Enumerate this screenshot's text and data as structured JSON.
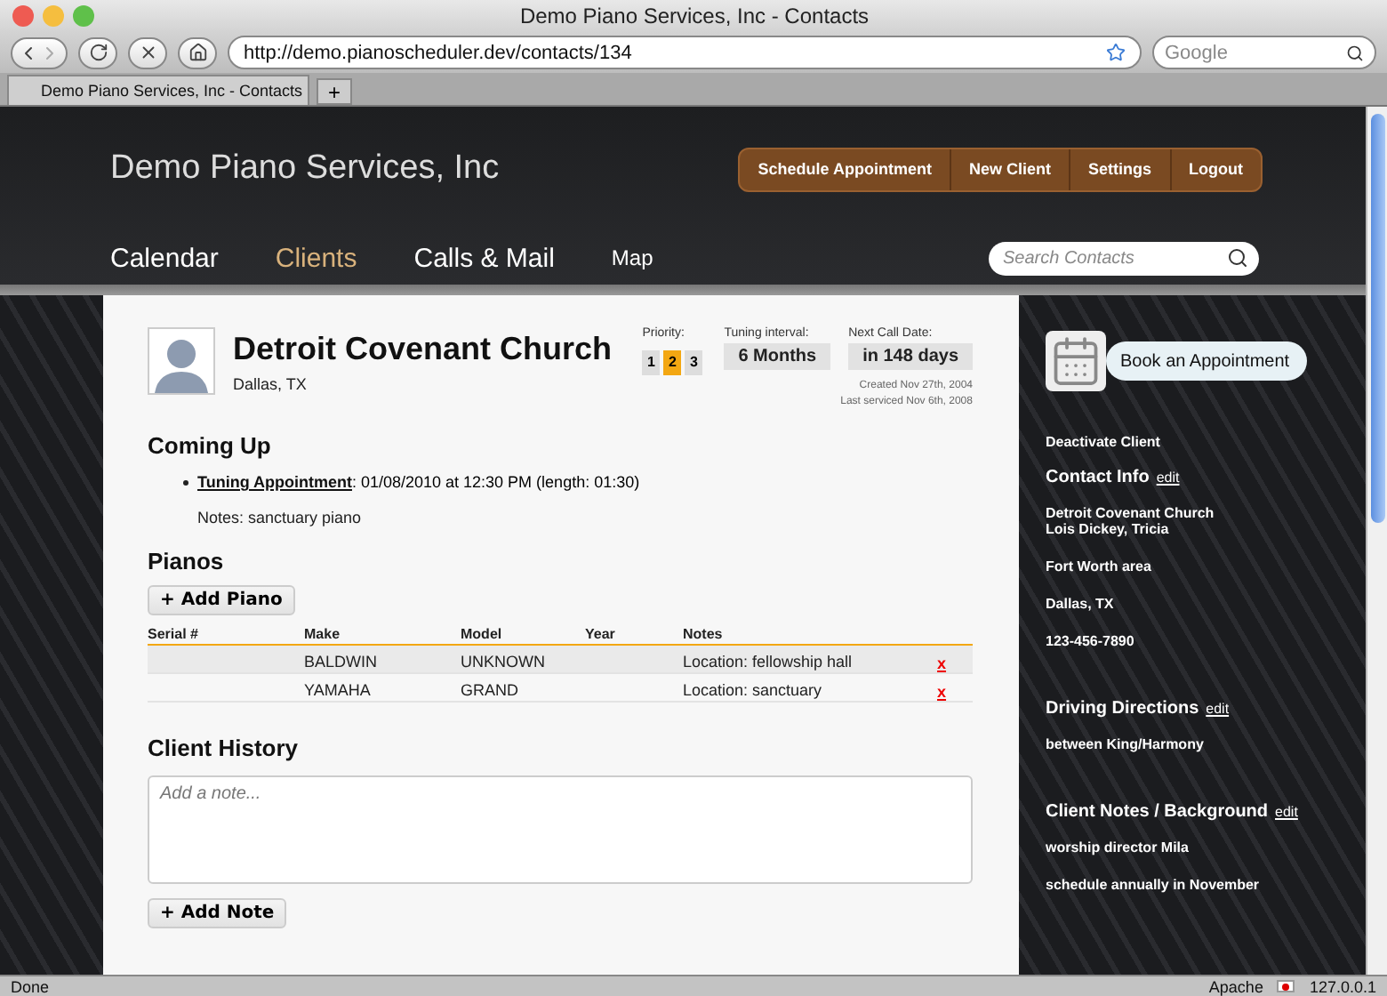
{
  "window": {
    "title": "Demo Piano Services, Inc - Contacts"
  },
  "browser": {
    "url": "http://demo.pianoscheduler.dev/contacts/134",
    "search_placeholder": "Google",
    "tabs": [
      {
        "label": "Demo Piano Services, Inc - Contacts",
        "selected": true
      }
    ],
    "new_tab": "+"
  },
  "header": {
    "brand": "Demo Piano Services, Inc",
    "menu": [
      "Schedule Appointment",
      "New Client",
      "Settings",
      "Logout"
    ],
    "nav": [
      {
        "label": "Calendar",
        "selected": false
      },
      {
        "label": "Clients",
        "selected": true
      },
      {
        "label": "Calls & Mail",
        "selected": false
      },
      {
        "label": "Map",
        "selected": false
      }
    ],
    "search_placeholder": "Search Contacts"
  },
  "contact": {
    "name": "Detroit Covenant Church",
    "location": "Dallas, TX",
    "priority": {
      "label": "Priority:",
      "options": [
        {
          "label": "1",
          "selected": false
        },
        {
          "label": "2",
          "selected": true
        },
        {
          "label": "3",
          "selected": false
        }
      ]
    },
    "tuning_interval": {
      "label": "Tuning interval:",
      "value": "6 Months"
    },
    "next_call": {
      "label": "Next Call Date:",
      "value": "in 148 days"
    },
    "created": "Created Nov 27th, 2004",
    "last_serviced": "Last serviced Nov 6th, 2008"
  },
  "coming_up": {
    "title": "Coming Up",
    "items": [
      {
        "link": "Tuning Appointment",
        "text": ": 01/08/2010 at 12:30 PM (length: 01:30)",
        "notes": "Notes: sanctuary piano"
      }
    ]
  },
  "pianos": {
    "title": "Pianos",
    "add_button": "+ Add Piano",
    "columns": [
      "Serial #",
      "Make",
      "Model",
      "Year",
      "Notes"
    ],
    "rows": [
      {
        "cells": [
          "",
          "BALDWIN",
          "UNKNOWN",
          "",
          "Location: fellowship hall"
        ],
        "delete": "x"
      },
      {
        "cells": [
          "",
          "YAMAHA",
          "GRAND",
          "",
          "Location: sanctuary"
        ],
        "delete": "x"
      }
    ]
  },
  "history": {
    "title": "Client History",
    "placeholder": "Add a note...",
    "add_button": "+ Add Note"
  },
  "sidebar": {
    "book_button": "Book an Appointment",
    "deactivate": "Deactivate Client",
    "sections": [
      {
        "title": "Contact Info",
        "edit": "edit",
        "lines": [
          [
            "Detroit Covenant Church",
            "Lois Dickey, Tricia"
          ],
          [
            "Fort Worth area"
          ],
          [
            "Dallas, TX"
          ],
          [
            "123-456-7890"
          ]
        ]
      },
      {
        "title": "Driving Directions",
        "edit": "edit",
        "lines": [
          [
            "between King/Harmony"
          ]
        ]
      },
      {
        "title": "Client Notes / Background",
        "edit": "edit",
        "lines": [
          [
            "worship director Mila"
          ],
          [
            "schedule annually in November"
          ]
        ]
      }
    ]
  },
  "status_bar": {
    "text": "Done",
    "server": "Apache",
    "ip": "127.0.0.1"
  }
}
